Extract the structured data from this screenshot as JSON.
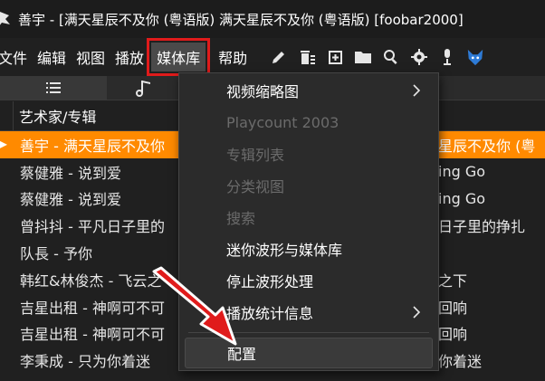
{
  "window": {
    "title": "善宇 - [满天星辰不及你 (粤语版) 满天星辰不及你 (粤语版)  [foobar2000]"
  },
  "menu": {
    "items": [
      {
        "label": "文件"
      },
      {
        "label": "编辑"
      },
      {
        "label": "视图"
      },
      {
        "label": "播放"
      },
      {
        "label": "媒体库"
      },
      {
        "label": "帮助"
      }
    ]
  },
  "toolbar": {
    "icons": [
      "pencil-icon",
      "trash-icon",
      "add-icon",
      "folder-icon",
      "search-icon",
      "gear-icon",
      "microphone-icon",
      "fox-icon"
    ]
  },
  "list": {
    "header": "艺术家/专辑",
    "rows": [
      {
        "left": "善宇 - 满天星辰不及你",
        "right": "星辰不及你 (粤",
        "selected": true
      },
      {
        "left": "蔡健雅 - 说到爱",
        "right": "ing Go",
        "selected": false
      },
      {
        "left": "蔡健雅 - 说到爱",
        "right": "ing Go",
        "selected": false
      },
      {
        "left": "曾抖抖 - 平凡日子里的",
        "right": "日子里的挣扎",
        "selected": false
      },
      {
        "left": "队長 - 予你",
        "right": "",
        "selected": false
      },
      {
        "left": "韩红&林俊杰 - 飞云之",
        "right": "之下",
        "selected": false
      },
      {
        "left": "吉星出租 - 神啊可不可",
        "right": "回响",
        "selected": false
      },
      {
        "left": "吉星出租 - 神啊可不可",
        "right": "回响",
        "selected": false
      },
      {
        "left": "李秉成 - 只为你着迷",
        "right": "你着迷",
        "selected": false
      }
    ]
  },
  "context_menu": {
    "items": [
      {
        "label": "视频缩略图",
        "disabled": false,
        "submenu": true
      },
      {
        "label": "Playcount 2003",
        "disabled": true,
        "submenu": false
      },
      {
        "label": "专辑列表",
        "disabled": true,
        "submenu": false
      },
      {
        "label": "分类视图",
        "disabled": true,
        "submenu": false
      },
      {
        "label": "搜索",
        "disabled": true,
        "submenu": false
      },
      {
        "label": "迷你波形与媒体库",
        "disabled": false,
        "submenu": false
      },
      {
        "label": "停止波形处理",
        "disabled": false,
        "submenu": false
      },
      {
        "label": "播放统计信息",
        "disabled": false,
        "submenu": true
      },
      {
        "label": "配置",
        "disabled": false,
        "submenu": false
      }
    ]
  },
  "colors": {
    "accent": "#ff8a00",
    "highlight_box": "#e01b1b",
    "background": "#202020",
    "menu_bg": "#2b2b2b"
  }
}
